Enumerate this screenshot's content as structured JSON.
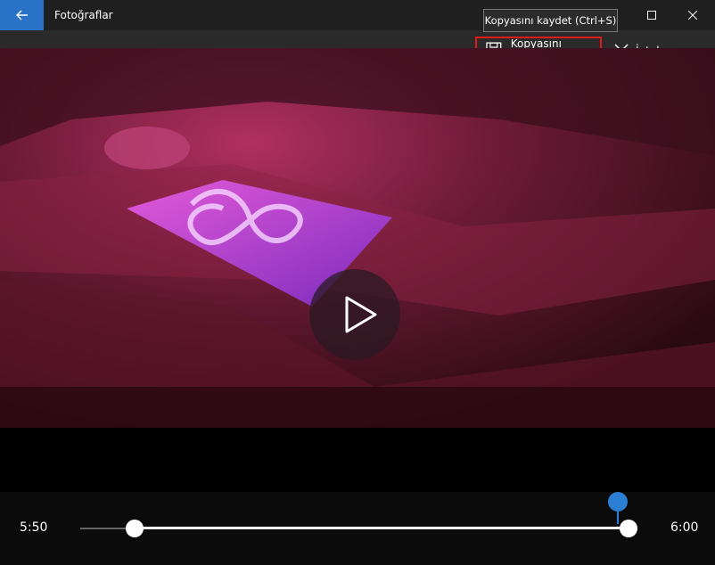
{
  "window": {
    "title": "Fotoğraflar",
    "back_icon": "arrow-left-icon",
    "accent_color": "#2a72c8"
  },
  "commandbar": {
    "save_label": "Kopyasını kaydet",
    "save_icon": "floppy-disk-icon",
    "cancel_label": "İptal",
    "cancel_icon": "close-x-icon",
    "more_icon": "more-dots-icon",
    "tooltip": "Kopyasını kaydet (Ctrl+S)",
    "highlight_color": "#e01919"
  },
  "player": {
    "start_time": "5:50",
    "end_time": "6:00",
    "play_icon": "play-icon",
    "trim_start_fraction": 0.1,
    "trim_end_fraction": 1.0,
    "playhead_fraction": 0.98,
    "playhead_color": "#2a7fd3"
  }
}
